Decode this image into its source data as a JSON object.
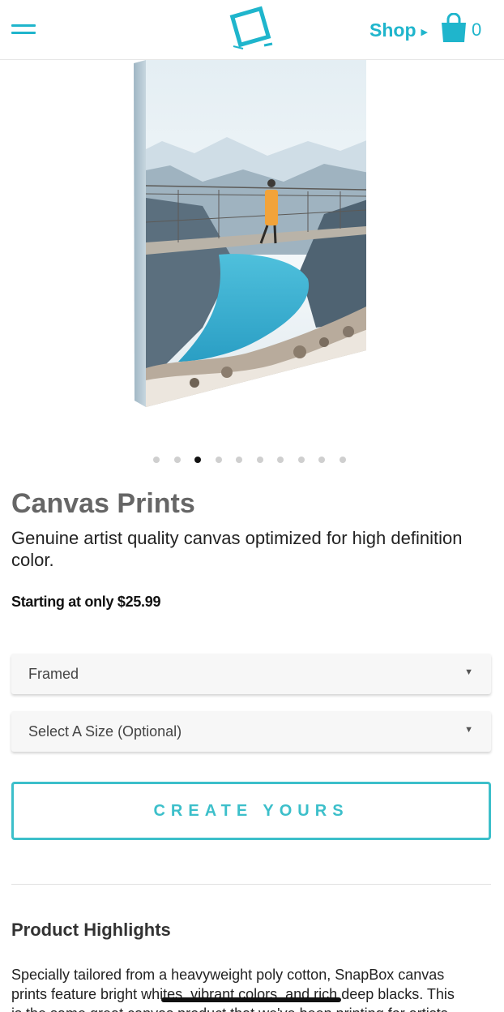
{
  "colors": {
    "accent": "#1fb5cc",
    "cta": "#3cbfca",
    "title": "#666666",
    "text": "#222222"
  },
  "header": {
    "shop_label": "Shop",
    "cart_count": "0"
  },
  "carousel": {
    "total": 10,
    "active_index": 2
  },
  "product": {
    "title": "Canvas Prints",
    "subtitle": "Genuine artist quality canvas optimized for high definition color.",
    "price_text": "Starting at only $25.99"
  },
  "options": {
    "frame_value": "Framed",
    "size_value": "Select A Size (Optional)"
  },
  "cta_label": "CREATE YOURS",
  "highlights": {
    "title": "Product Highlights",
    "lines": [
      "Specially tailored from a heavyweight poly cotton, SnapBox canvas",
      "prints feature bright whites, vibrant colors, and rich deep blacks. This",
      "is the same great canvas product that we've been printing for artists"
    ]
  }
}
